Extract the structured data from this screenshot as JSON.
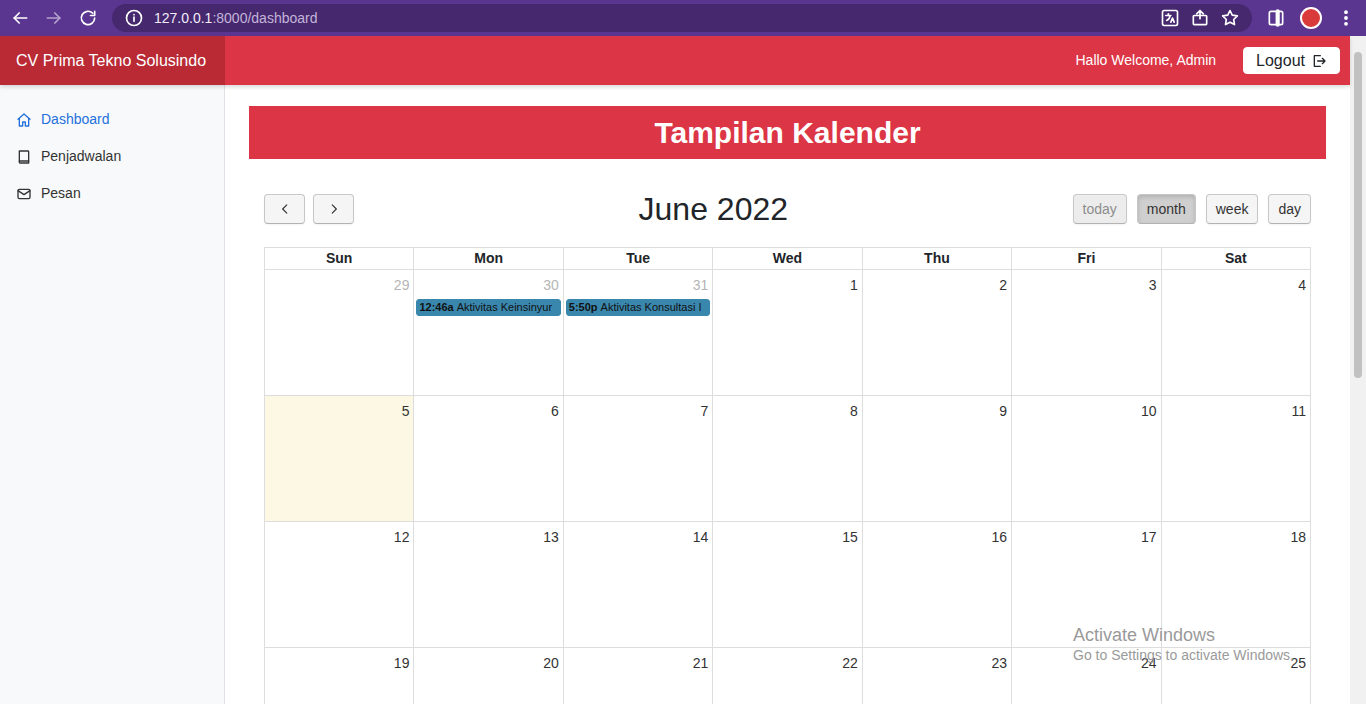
{
  "browser": {
    "host": "127.0.0.1",
    "path": ":8000/dashboard",
    "back_disabled": false,
    "forward_disabled": true
  },
  "navbar": {
    "brand": "CV Prima Tekno Solusindo",
    "greeting": "Hallo Welcome, Admin",
    "logout": "Logout"
  },
  "sidebar": {
    "items": [
      {
        "label": "Dashboard",
        "selected": true
      },
      {
        "label": "Penjadwalan",
        "selected": false
      },
      {
        "label": "Pesan",
        "selected": false
      }
    ]
  },
  "page": {
    "heading": "Tampilan Kalender"
  },
  "calendar": {
    "title": "June 2022",
    "views": [
      {
        "label": "today",
        "selected": false,
        "disabled": true
      },
      {
        "label": "month",
        "selected": true,
        "disabled": false
      },
      {
        "label": "week",
        "selected": false,
        "disabled": false
      },
      {
        "label": "day",
        "selected": false,
        "disabled": false
      }
    ],
    "weekdays": [
      "Sun",
      "Mon",
      "Tue",
      "Wed",
      "Thu",
      "Fri",
      "Sat"
    ],
    "weeks": [
      [
        {
          "day": "29",
          "other_month": true,
          "today": false,
          "events": []
        },
        {
          "day": "30",
          "other_month": true,
          "today": false,
          "events": [
            {
              "time": "12:46a",
              "title": "Aktivitas Keinsinyur",
              "color": "#3a87ad"
            }
          ]
        },
        {
          "day": "31",
          "other_month": true,
          "today": false,
          "events": [
            {
              "time": "5:50p",
              "title": "Aktivitas Konsultasi I",
              "color": "#3a87ad"
            }
          ]
        },
        {
          "day": "1",
          "other_month": false,
          "today": false,
          "events": []
        },
        {
          "day": "2",
          "other_month": false,
          "today": false,
          "events": []
        },
        {
          "day": "3",
          "other_month": false,
          "today": false,
          "events": []
        },
        {
          "day": "4",
          "other_month": false,
          "today": false,
          "events": []
        }
      ],
      [
        {
          "day": "5",
          "other_month": false,
          "today": true,
          "events": []
        },
        {
          "day": "6",
          "other_month": false,
          "today": false,
          "events": []
        },
        {
          "day": "7",
          "other_month": false,
          "today": false,
          "events": []
        },
        {
          "day": "8",
          "other_month": false,
          "today": false,
          "events": []
        },
        {
          "day": "9",
          "other_month": false,
          "today": false,
          "events": []
        },
        {
          "day": "10",
          "other_month": false,
          "today": false,
          "events": []
        },
        {
          "day": "11",
          "other_month": false,
          "today": false,
          "events": []
        }
      ],
      [
        {
          "day": "12",
          "other_month": false,
          "today": false,
          "events": []
        },
        {
          "day": "13",
          "other_month": false,
          "today": false,
          "events": []
        },
        {
          "day": "14",
          "other_month": false,
          "today": false,
          "events": []
        },
        {
          "day": "15",
          "other_month": false,
          "today": false,
          "events": []
        },
        {
          "day": "16",
          "other_month": false,
          "today": false,
          "events": []
        },
        {
          "day": "17",
          "other_month": false,
          "today": false,
          "events": []
        },
        {
          "day": "18",
          "other_month": false,
          "today": false,
          "events": []
        }
      ],
      [
        {
          "day": "19",
          "other_month": false,
          "today": false,
          "events": []
        },
        {
          "day": "20",
          "other_month": false,
          "today": false,
          "events": []
        },
        {
          "day": "21",
          "other_month": false,
          "today": false,
          "events": []
        },
        {
          "day": "22",
          "other_month": false,
          "today": false,
          "events": []
        },
        {
          "day": "23",
          "other_month": false,
          "today": false,
          "events": []
        },
        {
          "day": "24",
          "other_month": false,
          "today": false,
          "events": []
        },
        {
          "day": "25",
          "other_month": false,
          "today": false,
          "events": []
        }
      ]
    ]
  },
  "watermark": {
    "title": "Activate Windows",
    "subtitle": "Go to Settings to activate Windows."
  }
}
